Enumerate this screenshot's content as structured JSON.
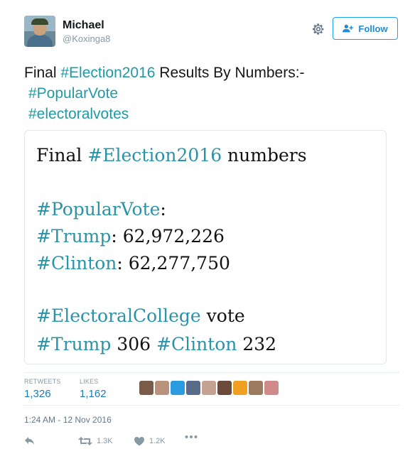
{
  "user": {
    "name": "Michael",
    "handle": "@Koxinga8"
  },
  "follow": {
    "label": "Follow"
  },
  "tweet": {
    "line1_prefix": "Final ",
    "line1_hashtag": "#Election2016",
    "line1_suffix": " Results By Numbers:-",
    "line2_hashtag": "#PopularVote",
    "line3_hashtag": "#electoralvotes"
  },
  "media": {
    "row1_prefix": "Final ",
    "row1_hashtag": "#Election2016",
    "row1_suffix": " numbers",
    "popular_hashtag": "#PopularVote",
    "popular_colon": ":",
    "trump_hashtag": "#Trump",
    "trump_value": ":  62,972,226",
    "clinton_hashtag": "#Clinton",
    "clinton_value": ": 62,277,750",
    "college_hashtag": "#ElectoralCollege",
    "college_suffix": " vote",
    "ev_trump_hashtag": "#Trump",
    "ev_trump_value": " 306 ",
    "ev_clinton_hashtag": "#Clinton",
    "ev_clinton_value": " 232"
  },
  "stats": {
    "retweets_label": "RETWEETS",
    "retweets_value": "1,326",
    "likes_label": "LIKES",
    "likes_value": "1,162",
    "liker_colors": [
      "#7a5a48",
      "#b8927a",
      "#2b9be0",
      "#5a6b8a",
      "#c4a394",
      "#6b4a3a",
      "#f0a020",
      "#9c7a5e",
      "#d08a8a"
    ]
  },
  "timestamp": "1:24 AM - 12 Nov 2016",
  "actions": {
    "retweet_count": "1.3K",
    "like_count": "1.2K"
  },
  "colors": {
    "hashtag": "#1e9aa6",
    "link_blue": "#1d8dd6",
    "muted": "#8899a6"
  }
}
